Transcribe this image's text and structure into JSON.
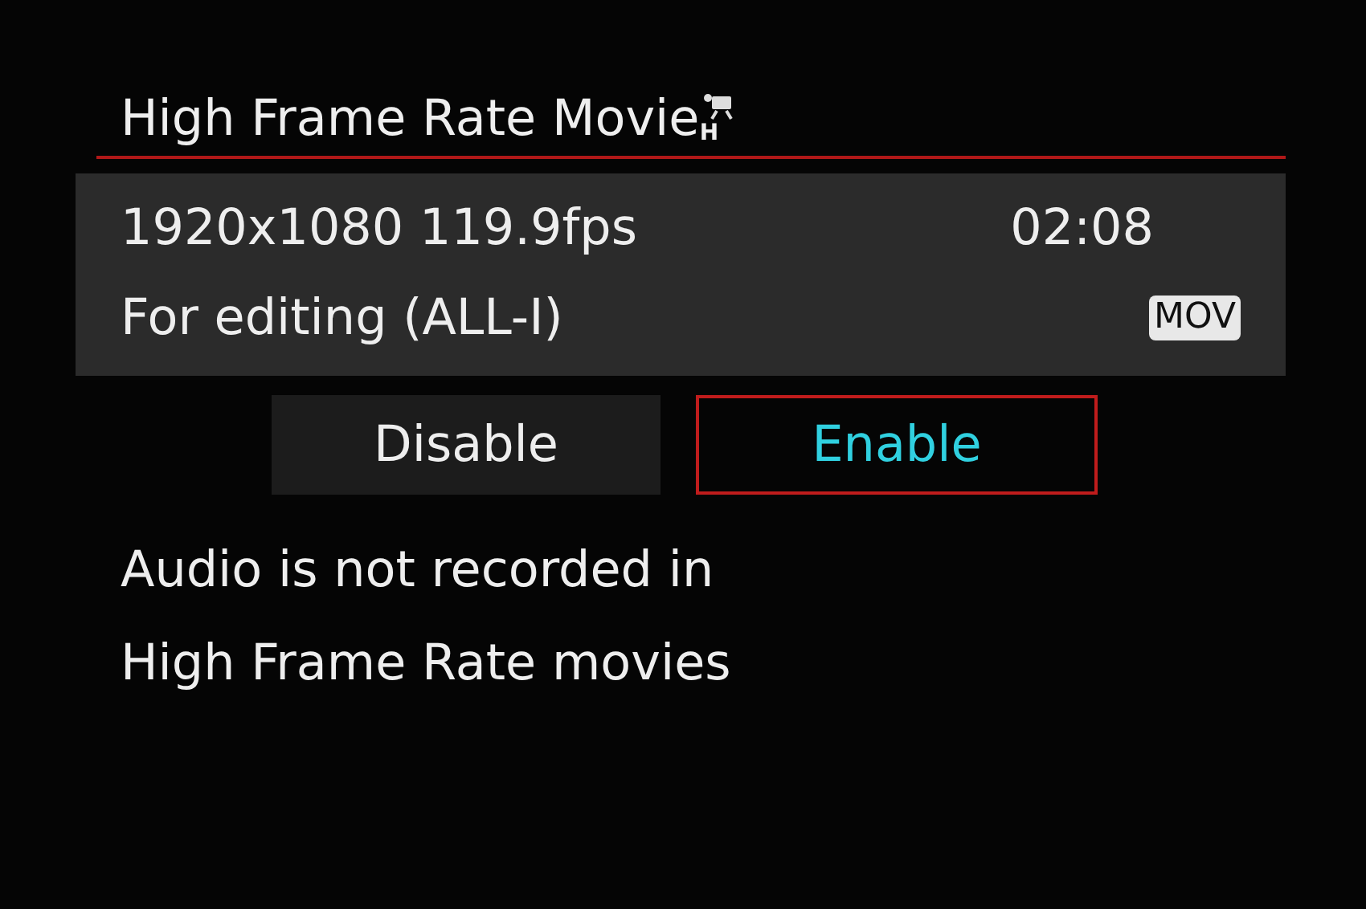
{
  "title": {
    "text": "High Frame Rate Movie",
    "icon_letter": "H"
  },
  "info": {
    "resolution": "1920x1080 119.9fps",
    "time": "02:08",
    "compression": "For editing (ALL-I)",
    "format_badge": "MOV"
  },
  "options": [
    {
      "label": "Disable",
      "selected": false
    },
    {
      "label": "Enable",
      "selected": true
    }
  ],
  "note": [
    "Audio is not recorded in",
    "High Frame Rate movies"
  ]
}
